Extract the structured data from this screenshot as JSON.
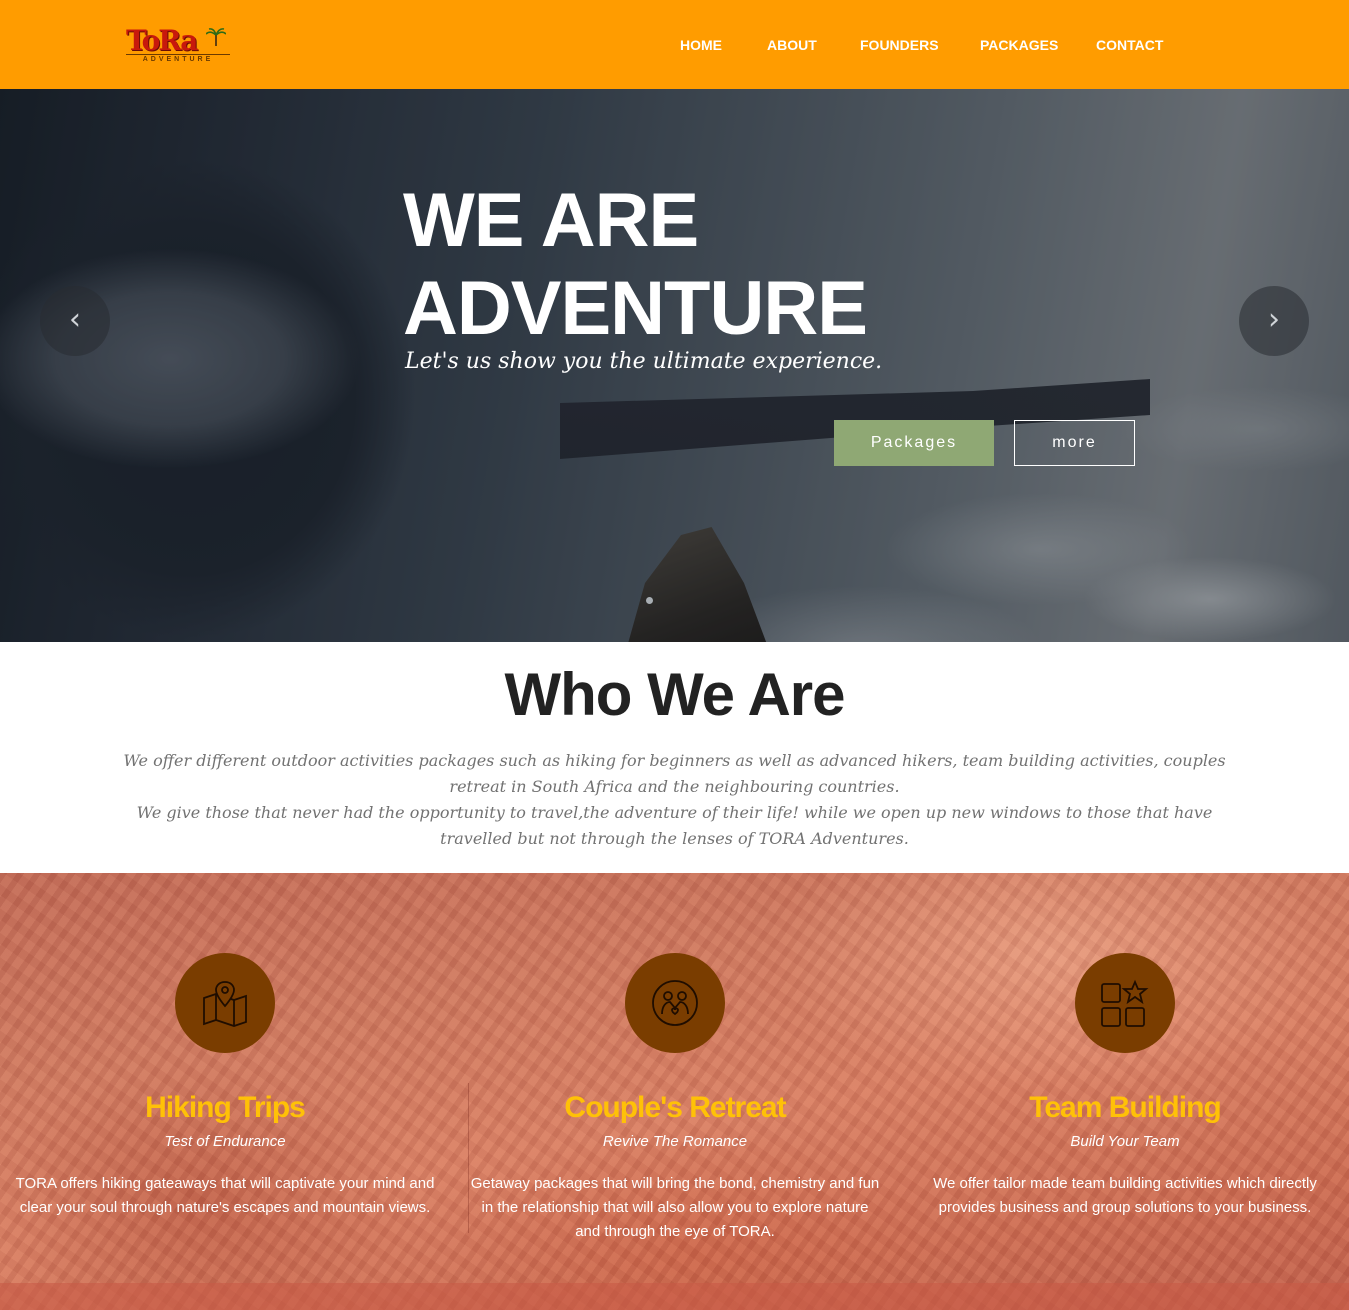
{
  "header": {
    "logo_text": "ToRa",
    "logo_subtext": "ADVENTURE",
    "nav": [
      "HOME",
      "ABOUT",
      "FOUNDERS",
      "PACKAGES",
      "CONTACT"
    ]
  },
  "hero": {
    "title_line1": "WE ARE",
    "title_line2": "ADVENTURE",
    "subtitle": "Let's us show you the ultimate experience.",
    "btn_primary": "Packages",
    "btn_secondary": "more",
    "prev_arrow": "‹",
    "next_arrow": "›"
  },
  "about": {
    "title": "Who We Are",
    "paragraph1": "We offer different outdoor activities packages such as hiking for beginners as well as advanced hikers, team building activities, couples retreat in South Africa and the neighbouring countries.",
    "paragraph2": "We give those that never had the opportunity to travel,the adventure of their life! while we open up new windows to those that have travelled but not through the lenses of TORA Adventures."
  },
  "services": [
    {
      "icon": "map-pin-icon",
      "title": "Hiking Trips",
      "subtitle": "Test of Endurance",
      "text": "TORA offers hiking gateaways that will captivate your mind and clear your soul through nature's escapes and mountain views."
    },
    {
      "icon": "couple-heart-icon",
      "title": "Couple's Retreat",
      "subtitle": "Revive The Romance",
      "text": "Getaway packages that will bring the bond, chemistry and fun in the relationship that will also allow you to explore nature and through the eye of TORA."
    },
    {
      "icon": "grid-star-icon",
      "title": "Team Building",
      "subtitle": "Build Your Team",
      "text": "We offer tailor made team building activities which directly provides business and group solutions to your business."
    }
  ],
  "colors": {
    "header_bg": "#ff9c00",
    "accent_green": "#8fa874",
    "service_title": "#ffc107",
    "icon_circle": "#7a3d00"
  }
}
